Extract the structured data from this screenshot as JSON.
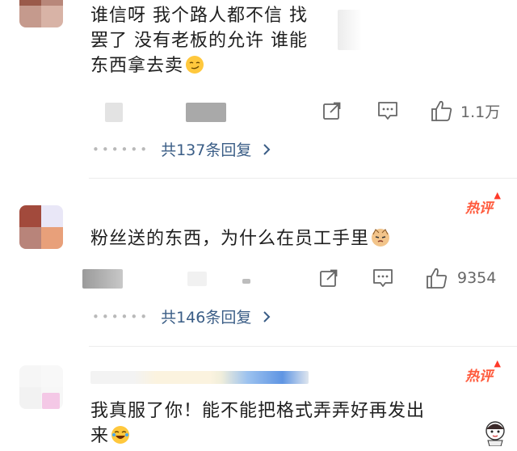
{
  "comments": [
    {
      "text": "谁信呀 我个路人都不信 找罢了 没有老板的允许 谁能东西拿去卖",
      "lines": [
        "谁信呀 我个路人都不信 找",
        "罢了 没有老板的允许 谁能",
        "东西拿去卖"
      ],
      "emoji": "smirk-emoji",
      "likes": "1.1万",
      "replies": "共137条回复"
    },
    {
      "badge": "热评",
      "lines": [
        "粉丝送的东西，为什么在员工手里"
      ],
      "emoji": "cat-emoji",
      "likes": "9354",
      "replies": "共146条回复"
    },
    {
      "badge": "热评",
      "lines": [
        "我真服了你！能不能把格式弄弄好再发出",
        "来"
      ],
      "emoji": "laugh-cry-emoji"
    }
  ],
  "icons": {
    "share": "share-icon",
    "comment": "comment-icon",
    "like": "thumbs-up-icon",
    "reply_chevron": "chevron-right-icon"
  },
  "colors": {
    "reply_link": "#3a5d86",
    "hot_badge": "#ff5a3c",
    "divider": "#ececec"
  }
}
